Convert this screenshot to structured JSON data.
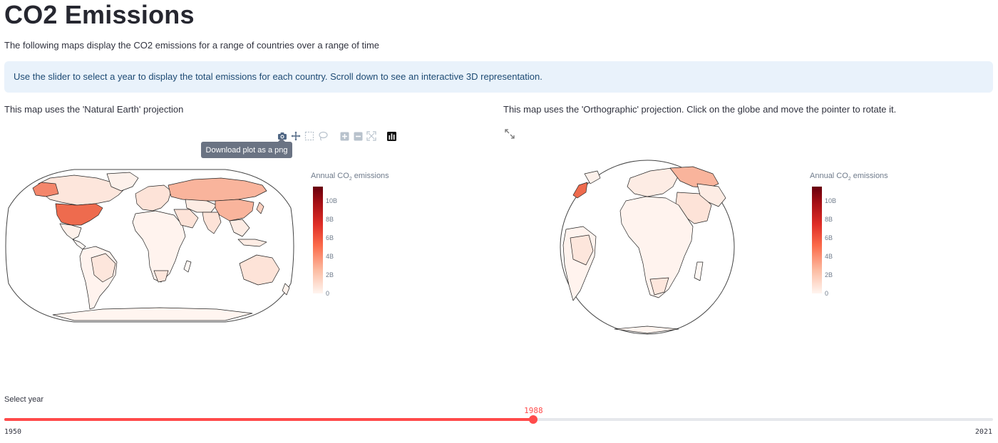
{
  "page": {
    "title": "CO2 Emissions",
    "intro": "The following maps display the CO2 emissions for a range of countries over a range of time",
    "info": "Use the slider to select a year to display the total emissions for each country. Scroll down to see an interactive 3D representation."
  },
  "left_map": {
    "caption": "This map uses the 'Natural Earth' projection",
    "projection": "Natural Earth",
    "tooltip": "Download plot as a png",
    "modebar_icons": [
      "camera-icon",
      "pan-icon",
      "box-select-icon",
      "lasso-icon",
      "zoom-in-icon",
      "zoom-out-icon",
      "autoscale-icon",
      "plotly-logo-icon"
    ]
  },
  "right_map": {
    "caption": "This map uses the 'Orthographic' projection. Click on the globe and move the pointer to rotate it.",
    "projection": "Orthographic",
    "fullscreen_icon": "expand-icon"
  },
  "colorbar": {
    "title_prefix": "Annual CO",
    "title_sub": "2",
    "title_suffix": " emissions",
    "ticks": [
      "10B",
      "8B",
      "6B",
      "4B",
      "2B",
      "0"
    ],
    "colors": [
      "#fff5f0",
      "#fcbba1",
      "#fb6a4a",
      "#de2d26",
      "#a50f15",
      "#67000d"
    ]
  },
  "slider": {
    "label": "Select year",
    "min_label": "1950",
    "max_label": "2021",
    "value_label": "1988",
    "min": 1950,
    "max": 2021,
    "value": 1988,
    "accent": "#ff4b4b"
  }
}
